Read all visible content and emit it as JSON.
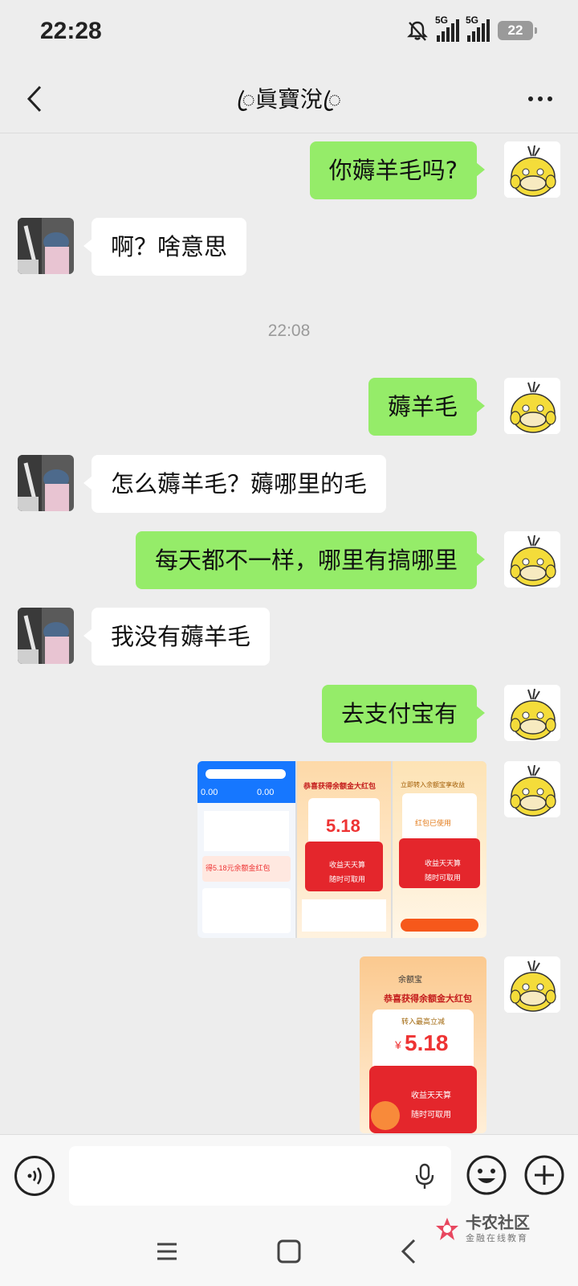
{
  "status": {
    "time": "22:28",
    "network1": "5G",
    "network2": "5G",
    "battery": "22"
  },
  "header": {
    "title": "ꦿ眞寶涗ꦿ"
  },
  "messages": [
    {
      "side": "out",
      "text": "你薅羊毛吗?"
    },
    {
      "side": "in",
      "text": "啊？啥意思"
    },
    {
      "side": "out",
      "text": "薅羊毛"
    },
    {
      "side": "in",
      "text": "怎么薅羊毛？薅哪里的毛"
    },
    {
      "side": "out",
      "text": "每天都不一样，哪里有搞哪里"
    },
    {
      "side": "in",
      "text": "我没有薅羊毛"
    },
    {
      "side": "out",
      "text": "去支付宝有"
    }
  ],
  "timestamp": "22:08",
  "image_message_1": {
    "panel1": {
      "amount_left": "0.00",
      "amount_right": "0.00",
      "banner": "得5.18元余额金红包"
    },
    "panel2": {
      "title": "恭喜获得余额金大红包",
      "amount": "5.18",
      "row1": "收益天天算",
      "row2": "随时可取用"
    },
    "panel3": {
      "title": "立即转入余额宝享收益",
      "status": "红包已使用",
      "row1": "收益天天算",
      "row2": "随时可取用"
    }
  },
  "image_message_2": {
    "brand": "余额宝",
    "title": "恭喜获得余额金大红包",
    "label": "转入最高立减",
    "currency": "¥",
    "amount": "5.18",
    "row1": "收益天天算",
    "row2": "随时可取用"
  },
  "input": {
    "placeholder": ""
  },
  "watermark": {
    "name": "卡农社区",
    "slogan": "金融在线教育"
  },
  "colors": {
    "outgoing_bubble": "#95ec69",
    "incoming_bubble": "#ffffff",
    "background": "#ededed"
  }
}
